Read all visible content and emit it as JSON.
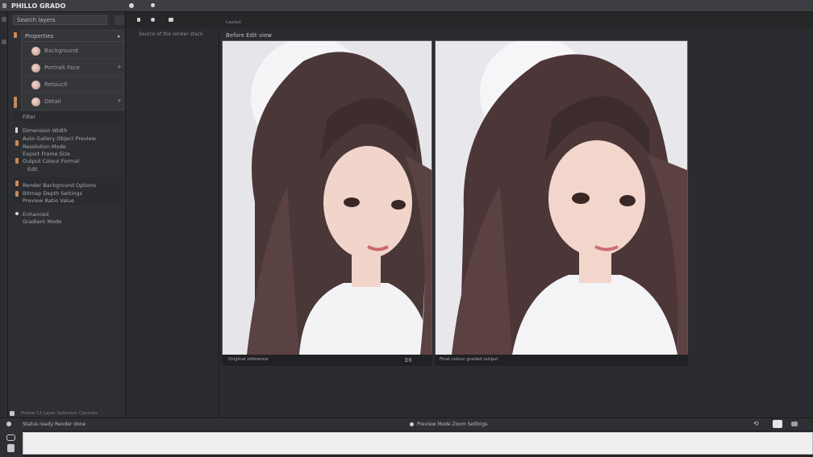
{
  "app": {
    "title": "PHILLO GRADO"
  },
  "panel": {
    "search_value": "Search layers",
    "layers_header": "Properties",
    "layers": [
      {
        "label": "Background",
        "mark": ""
      },
      {
        "label": "Portrait Face",
        "mark": "+"
      },
      {
        "label": "Retouch",
        "mark": ""
      },
      {
        "label": "Detail",
        "mark": "+"
      }
    ],
    "filter_label": "Filter",
    "properties": [
      {
        "text": "Dimension Width"
      },
      {
        "text": "Auto Gallery Object Preview"
      },
      {
        "text": "Resolution Mode"
      },
      {
        "text": "Export Frame Size"
      },
      {
        "text": "Output Colour Format"
      },
      {
        "text": "Edit"
      },
      {
        "text": "Render Background Options"
      },
      {
        "text": "Bitmap Depth Settings"
      },
      {
        "text": "Preview Ratio Value"
      },
      {
        "text": "Enhanced"
      },
      {
        "text": "Gradient Mode"
      }
    ],
    "footer_text": "Frame 12 Layer Selection Controls"
  },
  "panel2": {
    "header": "Source of the render stack"
  },
  "canvas": {
    "top_label": "Layout",
    "tab_label": "Before Edit  view",
    "left_caption": "Original reference",
    "left_badge": "E6",
    "right_caption": "Final colour graded output",
    "colors": {
      "background": "#e9e9ec",
      "hair": "#4a3535",
      "skin": "#f2d6cc",
      "shirt": "#f4f4f6"
    }
  },
  "statusbar": {
    "left_text": "Status ready  Render done",
    "center_text": "Preview Mode Zoom Settings",
    "input_value": ""
  }
}
